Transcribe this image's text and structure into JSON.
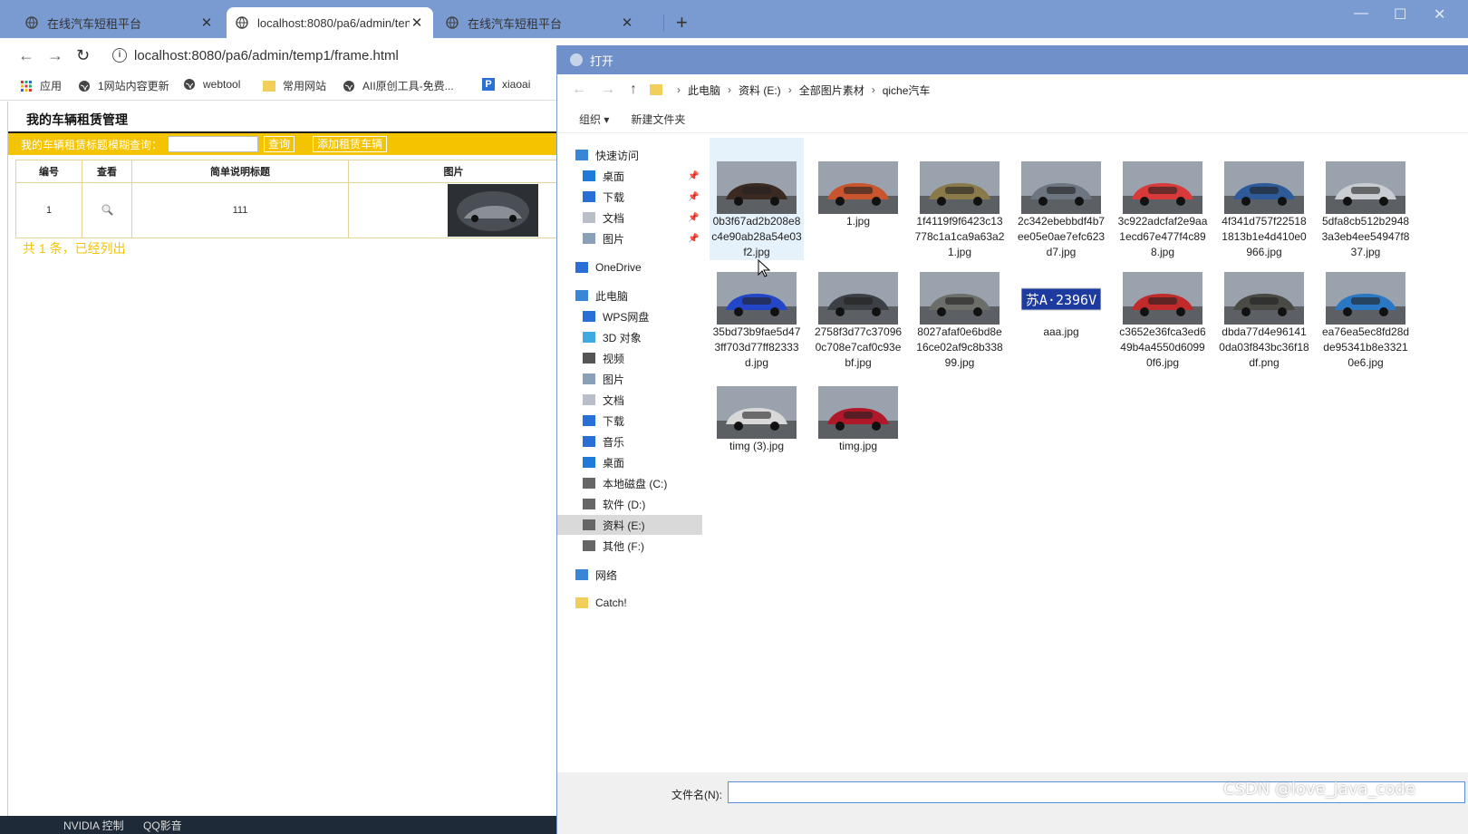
{
  "browser": {
    "tabs": [
      {
        "label": "在线汽车短租平台"
      },
      {
        "label": "localhost:8080/pa6/admin/ten"
      },
      {
        "label": "在线汽车短租平台"
      }
    ],
    "url": "localhost:8080/pa6/admin/temp1/frame.html",
    "bookmarks": [
      "应用",
      "1网站内容更新",
      "webtool",
      "常用网站",
      "AII原创工具-免费...",
      "xiaoai"
    ]
  },
  "page": {
    "title": "我的车辆租赁管理",
    "search_label": "我的车辆租赁标题模糊查询：",
    "search_value": "",
    "query_button": "查询",
    "add_button": "添加租赁车辆",
    "columns": [
      "编号",
      "查看",
      "简单说明标题",
      "图片"
    ],
    "rows": [
      {
        "id": "1",
        "title": "111"
      }
    ],
    "summary": "共 1 条，已经列出"
  },
  "taskbar": [
    "NVIDIA 控制",
    "QQ影音"
  ],
  "dialog": {
    "title": "打开",
    "breadcrumbs": [
      "此电脑",
      "资料 (E:)",
      "全部图片素材",
      "qiche汽车"
    ],
    "tools": [
      "组织 ▾",
      "新建文件夹"
    ],
    "nav": [
      {
        "label": "快速访问",
        "icon": "star-icon",
        "pin": false
      },
      {
        "label": "桌面",
        "icon": "desktop-icon",
        "pin": true
      },
      {
        "label": "下载",
        "icon": "download-icon",
        "pin": true
      },
      {
        "label": "文档",
        "icon": "document-icon",
        "pin": true
      },
      {
        "label": "图片",
        "icon": "picture-icon",
        "pin": true
      },
      {
        "label": "OneDrive",
        "icon": "cloud-icon",
        "pin": false
      },
      {
        "label": "此电脑",
        "icon": "computer-icon",
        "pin": false
      },
      {
        "label": "WPS网盘",
        "icon": "cloud-icon",
        "pin": false
      },
      {
        "label": "3D 对象",
        "icon": "cube-icon",
        "pin": false
      },
      {
        "label": "视频",
        "icon": "video-icon",
        "pin": false
      },
      {
        "label": "图片",
        "icon": "picture-icon",
        "pin": false
      },
      {
        "label": "文档",
        "icon": "document-icon",
        "pin": false
      },
      {
        "label": "下载",
        "icon": "download-icon",
        "pin": false
      },
      {
        "label": "音乐",
        "icon": "music-icon",
        "pin": false
      },
      {
        "label": "桌面",
        "icon": "desktop-icon",
        "pin": false
      },
      {
        "label": "本地磁盘 (C:)",
        "icon": "drive-icon",
        "pin": false
      },
      {
        "label": "软件 (D:)",
        "icon": "drive-icon",
        "pin": false
      },
      {
        "label": "资料 (E:)",
        "icon": "drive-icon",
        "pin": false,
        "selected": true
      },
      {
        "label": "其他 (F:)",
        "icon": "drive-icon",
        "pin": false
      },
      {
        "label": "网络",
        "icon": "network-icon",
        "pin": false
      },
      {
        "label": "Catch!",
        "icon": "folder-icon",
        "pin": false
      }
    ],
    "files": [
      {
        "name": "0b3f67ad2b208e8c4e90ab28a54e03f2.jpg",
        "color": "#3a2a22",
        "selected": true
      },
      {
        "name": "1.jpg",
        "color": "#c8552e"
      },
      {
        "name": "1f4119f9f6423c13778c1a1ca9a63a21.jpg",
        "color": "#8a7a4a"
      },
      {
        "name": "2c342ebebbdf4b7ee05e0ae7efc623d7.jpg",
        "color": "#6d7580"
      },
      {
        "name": "3c922adcfaf2e9aa1ecd67e477f4c898.jpg",
        "color": "#d83a3a"
      },
      {
        "name": "4f341d757f225181813b1e4d410e0966.jpg",
        "color": "#2f5a9a"
      },
      {
        "name": "5dfa8cb512b29483a3eb4ee54947f837.jpg",
        "color": "#c9cdd2"
      },
      {
        "name": "35bd73b9fae5d473ff703d77ff82333d.jpg",
        "color": "#2346c8"
      },
      {
        "name": "2758f3d77c370960c708e7caf0c93ebf.jpg",
        "color": "#3c3f44"
      },
      {
        "name": "8027afaf0e6bd8e16ce02af9c8b33899.jpg",
        "color": "#6c6e6a"
      },
      {
        "name": "aaa.jpg",
        "color": "#1d3aa0",
        "plate": "苏A·2396V"
      },
      {
        "name": "c3652e36fca3ed649b4a4550d60990f6.jpg",
        "color": "#c02a2a"
      },
      {
        "name": "dbda77d4e961410da03f843bc36f18df.png",
        "color": "#4a4a45"
      },
      {
        "name": "ea76ea5ec8fd28dde95341b8e33210e6.jpg",
        "color": "#2a78c4"
      },
      {
        "name": "timg (3).jpg",
        "color": "#d8d8d8"
      },
      {
        "name": "timg.jpg",
        "color": "#b0182a"
      }
    ],
    "filename_label": "文件名(N):",
    "filename_value": ""
  },
  "watermark": "CSDN @love_java_code",
  "colors": {
    "accent_yellow": "#f5c400",
    "tabstrip": "#7a9bd1",
    "dialog_title": "#6f90c9"
  }
}
